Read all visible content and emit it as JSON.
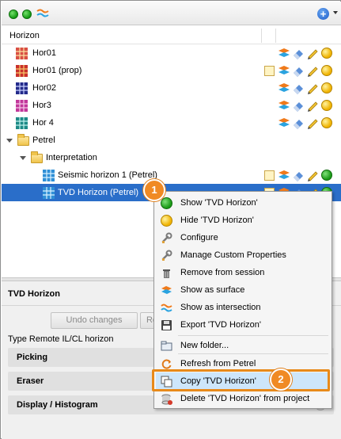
{
  "tree": {
    "column_header": "Horizon",
    "rows": [
      {
        "label": "Hor01"
      },
      {
        "label": "Hor01 (prop)"
      },
      {
        "label": "Hor02"
      },
      {
        "label": "Hor3"
      },
      {
        "label": "Hor 4"
      },
      {
        "label": "Petrel"
      },
      {
        "label": "Interpretation"
      },
      {
        "label": "Seismic horizon 1 (Petrel)"
      },
      {
        "label": "TVD Horizon (Petrel)"
      }
    ]
  },
  "props": {
    "title": "TVD Horizon",
    "undo_label": "Undo changes",
    "redo_label": "Re",
    "type_line": "Type Remote IL/CL horizon",
    "sections": [
      "Picking",
      "Eraser",
      "Display / Histogram"
    ]
  },
  "menu": {
    "items": [
      {
        "label": "Show 'TVD Horizon'",
        "icon": "green-circle-icon"
      },
      {
        "label": "Hide 'TVD Horizon'",
        "icon": "yellow-circle-icon"
      },
      {
        "label": "Configure",
        "icon": "wrench-icon"
      },
      {
        "label": "Manage Custom Properties",
        "icon": "wrench-icon"
      },
      {
        "label": "Remove from session",
        "icon": "trash-icon"
      },
      {
        "label": "Show as surface",
        "icon": "surface-icon"
      },
      {
        "label": "Show as intersection",
        "icon": "intersection-icon"
      },
      {
        "label": "Export 'TVD Horizon'",
        "icon": "disk-icon"
      },
      {
        "label": "New folder...",
        "icon": "folder-icon"
      },
      {
        "label": "Refresh from Petrel",
        "icon": "refresh-icon"
      },
      {
        "label": "Copy 'TVD Horizon'",
        "icon": "copy-icon"
      },
      {
        "label": "Delete 'TVD Horizon' from project",
        "icon": "delete-icon"
      }
    ]
  },
  "callouts": [
    "1",
    "2"
  ],
  "colors": {
    "selection": "#2a6ec9",
    "callout": "#f08a24",
    "menu_highlight": "#cde6fb"
  }
}
